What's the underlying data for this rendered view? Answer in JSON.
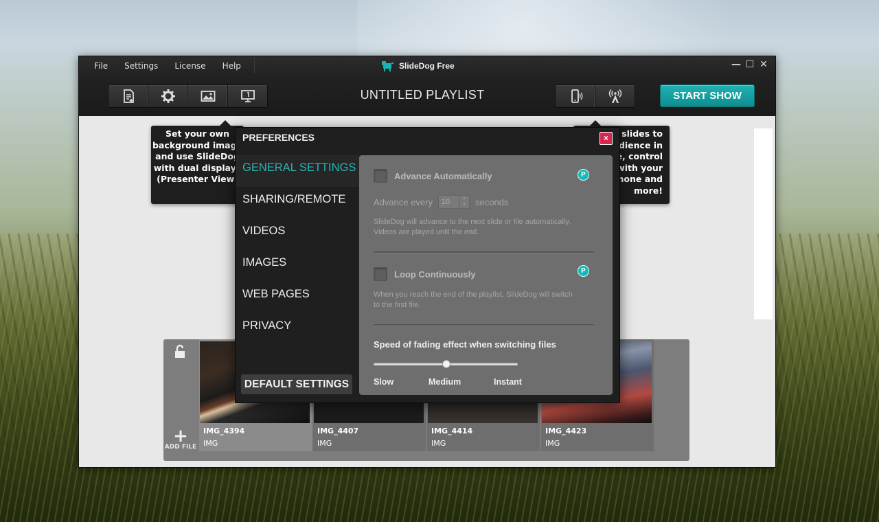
{
  "app": {
    "title": "SlideDog Free",
    "menu": [
      "File",
      "Settings",
      "License",
      "Help"
    ],
    "window_controls": {
      "minimize": "—",
      "maximize": "☐",
      "close": "✕"
    }
  },
  "toolbar": {
    "left_icons": [
      "add-file-icon",
      "gear-icon",
      "image-icon",
      "monitor-icon"
    ],
    "right_icons": [
      "phone-remote-icon",
      "broadcast-icon"
    ],
    "playlist_title": "UNTITLED PLAYLIST",
    "start_label": "START SHOW",
    "accent": "#13a5a6"
  },
  "tips": {
    "left": [
      "Set your own",
      "background image",
      "and use SlideDog",
      "with dual displays",
      "(Presenter View)"
    ],
    "right": [
      "slides to",
      "dience in",
      "e, control",
      "with your",
      "hone and",
      "more!"
    ]
  },
  "filmstrip": {
    "add_label": "ADD FILE",
    "items": [
      {
        "name": "IMG_4394",
        "type": "IMG"
      },
      {
        "name": "IMG_4407",
        "type": "IMG"
      },
      {
        "name": "IMG_4414",
        "type": "IMG"
      },
      {
        "name": "IMG_4423",
        "type": "IMG"
      }
    ]
  },
  "dialog": {
    "title": "PREFERENCES",
    "close": "×",
    "nav": [
      "GENERAL SETTINGS",
      "SHARING/REMOTE",
      "VIDEOS",
      "IMAGES",
      "WEB PAGES",
      "PRIVACY"
    ],
    "active_nav": "GENERAL SETTINGS",
    "default_button": "DEFAULT SETTINGS",
    "general": {
      "advance_label": "Advance Automatically",
      "advance_checked": false,
      "advance_every_prefix": "Advance every",
      "advance_every_value": "10",
      "advance_every_suffix": "seconds",
      "advance_desc_1": "SlideDog will advance to the next slide or file automatically.",
      "advance_desc_2": "Videos are played unlil the end.",
      "loop_label": "Loop Continuously",
      "loop_checked": false,
      "loop_desc_1": "When you reach the end of the playlist, SlideDog will switch",
      "loop_desc_2": "to the first file.",
      "pro_badge": "P",
      "speed_label": "Speed of fading effect when switching files",
      "speed_ticks": [
        "Slow",
        "Medium",
        "Instant"
      ],
      "speed_value": "Medium"
    }
  }
}
